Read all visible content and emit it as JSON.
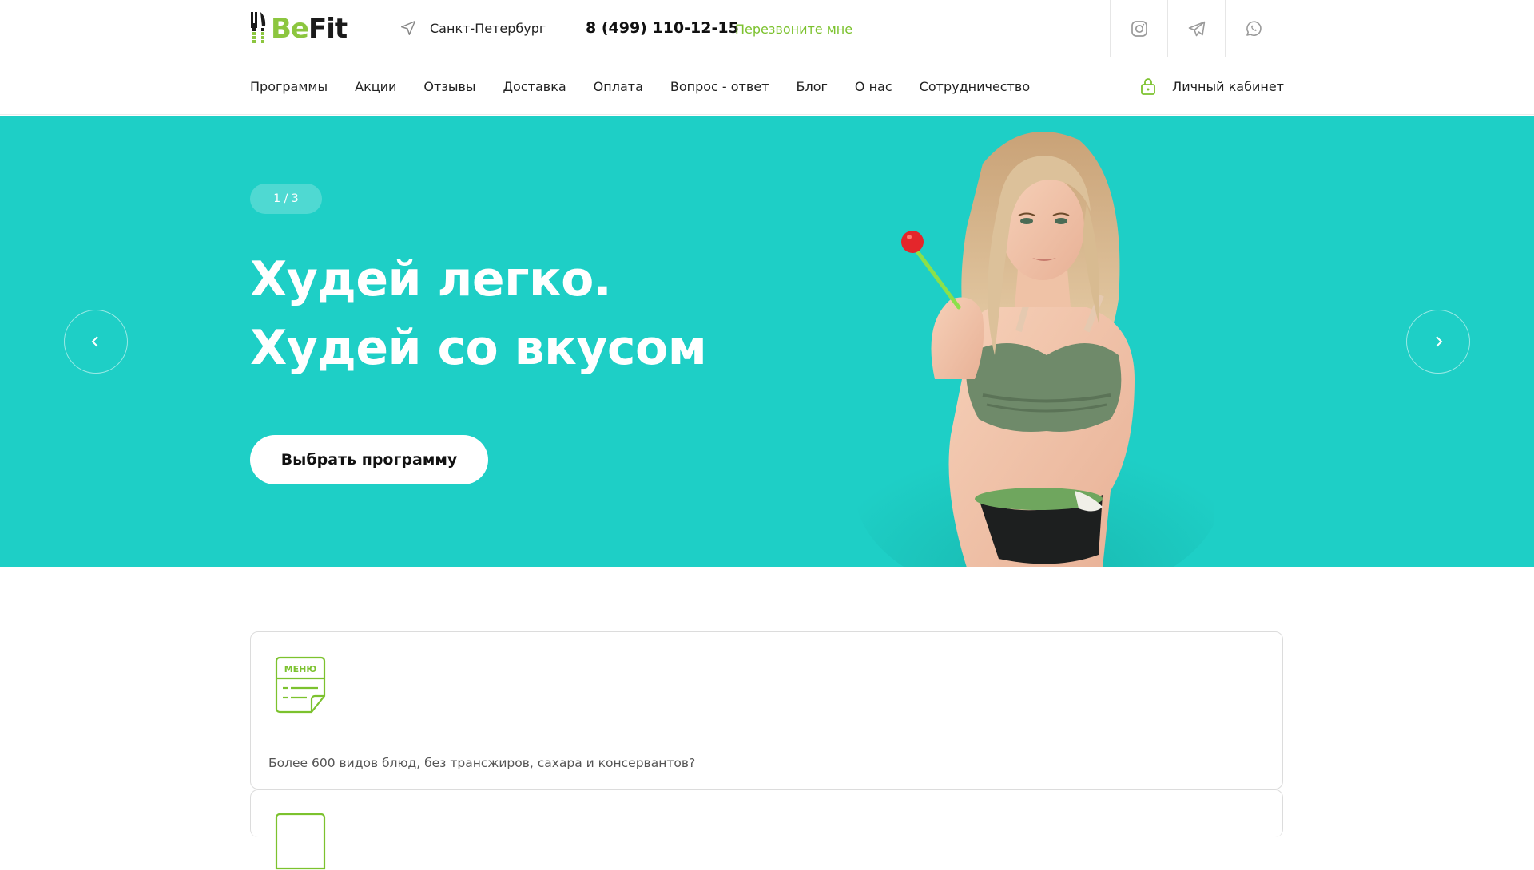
{
  "header": {
    "logo_part1": "Be",
    "logo_part2": "Fit",
    "city": "Санкт-Петербург",
    "phone": "8 (499) 110-12-15",
    "callback_label": "Перезвоните мне",
    "socials": [
      "instagram-icon",
      "telegram-icon",
      "whatsapp-icon"
    ]
  },
  "nav": {
    "items": [
      "Программы",
      "Акции",
      "Отзывы",
      "Доставка",
      "Оплата",
      "Вопрос - ответ",
      "Блог",
      "О нас",
      "Сотрудничество"
    ],
    "cabinet_label": "Личный кабинет"
  },
  "hero": {
    "slide_counter": "1 / 3",
    "title_line1": "Худей легко.",
    "title_line2": "Худей со вкусом",
    "cta_label": "Выбрать программу"
  },
  "features": [
    {
      "icon_text": "МЕНЮ",
      "text": "Более 600 видов блюд, без трансжиров, сахара и консервантов?"
    }
  ],
  "colors": {
    "accent_green": "#8cc63f",
    "hero_bg": "#1ecfc6",
    "link_green": "#7cc22e"
  }
}
